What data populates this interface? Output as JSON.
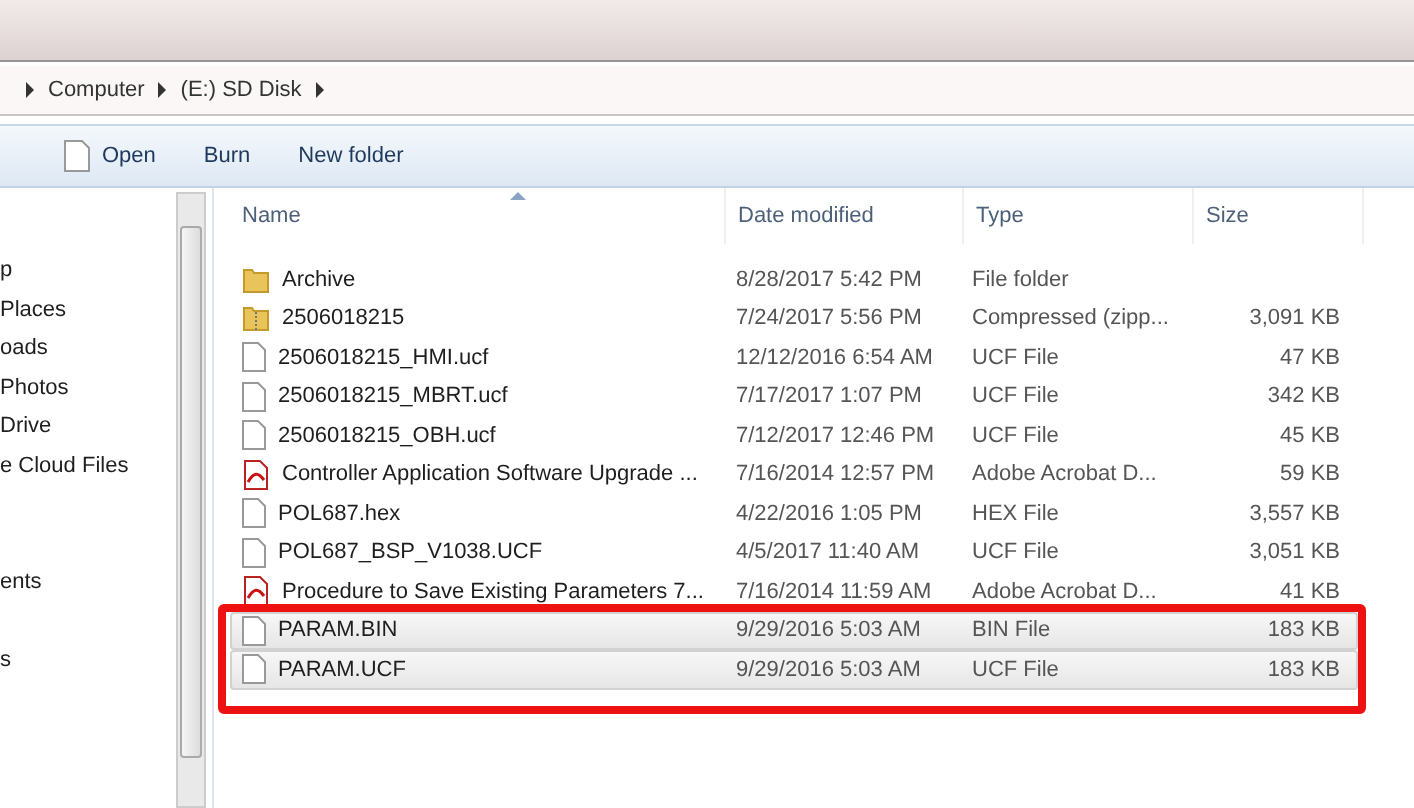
{
  "breadcrumb": [
    "Computer",
    "(E:) SD Disk"
  ],
  "toolbar": [
    {
      "label": "Open",
      "kind": "icon"
    },
    {
      "label": "Burn",
      "kind": "plain"
    },
    {
      "label": "New folder",
      "kind": "plain"
    }
  ],
  "sidebar": {
    "items": [
      "p",
      "Places",
      "oads",
      "Photos",
      "Drive",
      "e Cloud Files",
      "ents",
      "s"
    ]
  },
  "table": {
    "columns": [
      "Name",
      "Date modified",
      "Type",
      "Size"
    ],
    "rows": [
      {
        "name": "Archive",
        "date": "8/28/2017 5:42 PM",
        "type": "File folder",
        "size": "",
        "kind": "folder",
        "selected": false
      },
      {
        "name": "2506018215",
        "date": "7/24/2017 5:56 PM",
        "type": "Compressed (zipp...",
        "size": "3,091 KB",
        "kind": "zip",
        "selected": false
      },
      {
        "name": "2506018215_HMI.ucf",
        "date": "12/12/2016 6:54 AM",
        "type": "UCF File",
        "size": "47 KB",
        "kind": "file",
        "selected": false
      },
      {
        "name": "2506018215_MBRT.ucf",
        "date": "7/17/2017 1:07 PM",
        "type": "UCF File",
        "size": "342 KB",
        "kind": "file",
        "selected": false
      },
      {
        "name": "2506018215_OBH.ucf",
        "date": "7/12/2017 12:46 PM",
        "type": "UCF File",
        "size": "45 KB",
        "kind": "file",
        "selected": false
      },
      {
        "name": "Controller Application Software Upgrade ...",
        "date": "7/16/2014 12:57 PM",
        "type": "Adobe Acrobat D...",
        "size": "59 KB",
        "kind": "pdf",
        "selected": false
      },
      {
        "name": "POL687.hex",
        "date": "4/22/2016 1:05 PM",
        "type": "HEX File",
        "size": "3,557 KB",
        "kind": "file",
        "selected": false
      },
      {
        "name": "POL687_BSP_V1038.UCF",
        "date": "4/5/2017 11:40 AM",
        "type": "UCF File",
        "size": "3,051 KB",
        "kind": "file",
        "selected": false
      },
      {
        "name": "Procedure to Save Existing Parameters 7...",
        "date": "7/16/2014 11:59 AM",
        "type": "Adobe Acrobat D...",
        "size": "41 KB",
        "kind": "pdf",
        "selected": false
      },
      {
        "name": "PARAM.BIN",
        "date": "9/29/2016 5:03 AM",
        "type": "BIN File",
        "size": "183 KB",
        "kind": "file",
        "selected": true
      },
      {
        "name": "PARAM.UCF",
        "date": "9/29/2016 5:03 AM",
        "type": "UCF File",
        "size": "183 KB",
        "kind": "file",
        "selected": true
      }
    ]
  }
}
